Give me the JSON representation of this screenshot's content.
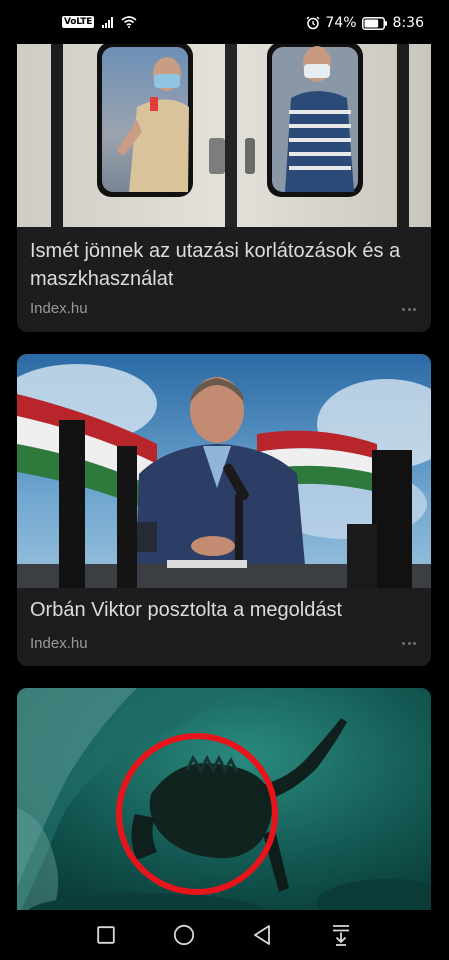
{
  "status_bar": {
    "volte": "VoLTE",
    "battery_percent": "74%",
    "time": "8:36",
    "battery_level": 0.74
  },
  "feed": {
    "cards": [
      {
        "title": "Ismét jönnek az utazási korlátozások és a maszkhasználat",
        "source": "Index.hu",
        "image": "subway-train-masked-passengers"
      },
      {
        "title": "Orbán Viktor posztolta a megoldást",
        "source": "Index.hu",
        "image": "man-at-radio-microphone-with-flag"
      },
      {
        "image": "underwater-crocodile-red-circle"
      }
    ]
  },
  "nav_bar": {
    "buttons": [
      "recent-apps-icon",
      "home-icon",
      "back-icon",
      "notification-shade-icon"
    ]
  },
  "colors": {
    "background": "#000000",
    "card": "#1d1d1f",
    "title": "#dcdcdc",
    "source": "#9a9a9a",
    "highlight_circle": "#e8141c"
  }
}
